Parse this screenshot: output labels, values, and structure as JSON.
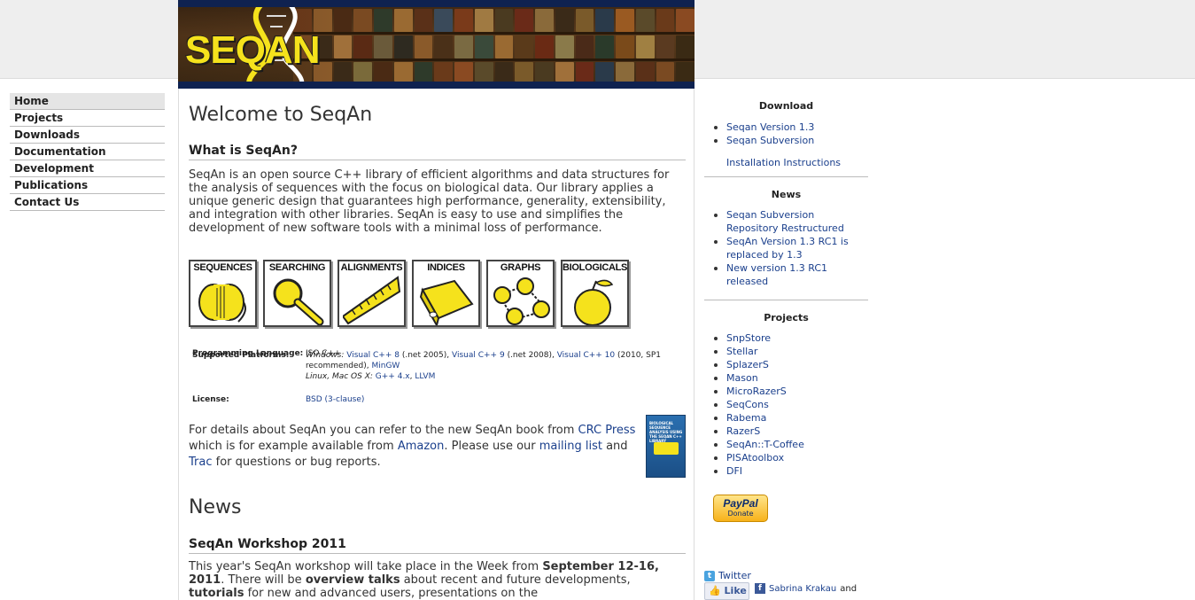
{
  "logo": {
    "text": "SEQAN"
  },
  "nav": {
    "items": [
      {
        "label": "Home",
        "active": true
      },
      {
        "label": "Projects"
      },
      {
        "label": "Downloads"
      },
      {
        "label": "Documentation"
      },
      {
        "label": "Development"
      },
      {
        "label": "Publications"
      },
      {
        "label": "Contact Us"
      }
    ]
  },
  "main": {
    "title": "Welcome to SeqAn",
    "what_heading": "What is SeqAn?",
    "intro": "SeqAn is an open source C++ library of efficient algorithms and data structures for the analysis of sequences with the focus on biological data. Our library applies a unique generic design that guarantees high performance, generality, extensibility, and integration with other libraries. SeqAn is easy to use and simplifies the development of new software tools with a minimal loss of performance.",
    "icons": [
      "SEQUENCES",
      "SEARCHING",
      "ALIGNMENTS",
      "INDICES",
      "GRAPHS",
      "BIOLOGICALS"
    ],
    "info": {
      "lang_key": "Programming Language:",
      "lang_val": "ISO C++",
      "plat_key": "Supported Platforms:",
      "plat_windows": "Windows:",
      "plat_vc8": "Visual C++ 8",
      "plat_vc8_note": "(.net 2005),",
      "plat_vc9": "Visual C++ 9",
      "plat_vc9_note": "(.net 2008),",
      "plat_vc10": "Visual C++ 10",
      "plat_vc10_note": "(2010, SP1 recommended),",
      "plat_mingw": "MinGW",
      "plat_unix": "Linux, Mac OS X:",
      "plat_gcc": "G++ 4.x",
      "plat_comma": ",",
      "plat_llvm": "LLVM",
      "license_key": "License:",
      "license_val": "BSD (3-clause)"
    },
    "details": {
      "t1": "For details about SeqAn you can refer to the new SeqAn book from ",
      "crc": "CRC Press",
      "t2": " which is for example available from ",
      "amazon": "Amazon",
      "t3": ". Please use our ",
      "mailing": "mailing list",
      "t4": " and ",
      "trac": "Trac",
      "t5": " for questions or bug reports."
    },
    "book_cover_title": "BIOLOGICAL SEQUENCE ANALYSIS USING THE SEQAN C++ LIBRARY",
    "news_title": "News",
    "workshop_heading": "SeqAn Workshop 2011",
    "workshop": {
      "t1": "This year's SeqAn workshop will take place in the Week from ",
      "b1": "September 12-16, 2011",
      "t2": ". There will be ",
      "b2": "overview talks",
      "t3": " about recent and future developments, ",
      "b3": "tutorials",
      "t4": " for new and advanced users, presentations on the"
    }
  },
  "sidebar": {
    "download_heading": "Download",
    "download_items": [
      "Seqan Version 1.3",
      "Seqan Subversion"
    ],
    "install_link": "Installation Instructions",
    "news_heading": "News",
    "news_items": [
      "Seqan Subversion Repository Restructured",
      "SeqAn Version 1.3 RC1 is replaced by 1.3",
      "New version 1.3 RC1 released"
    ],
    "projects_heading": "Projects",
    "projects_items": [
      "SnpStore",
      "Stellar",
      "SplazerS",
      "Mason",
      "MicroRazerS",
      "SeqCons",
      "Rabema",
      "RazerS",
      "SeqAn::T-Coffee",
      "PISAtoolbox",
      "DFI"
    ],
    "paypal_logo": "PayPal",
    "paypal_donate": "Donate",
    "twitter_label": "Twitter",
    "like_label": "Like",
    "fb_user": "Sabrina Krakau",
    "fb_and": "and"
  },
  "colors": {
    "link": "#1a3f8c",
    "logo_yellow": "#f5e21c",
    "banner_navy": "#0f2250"
  }
}
